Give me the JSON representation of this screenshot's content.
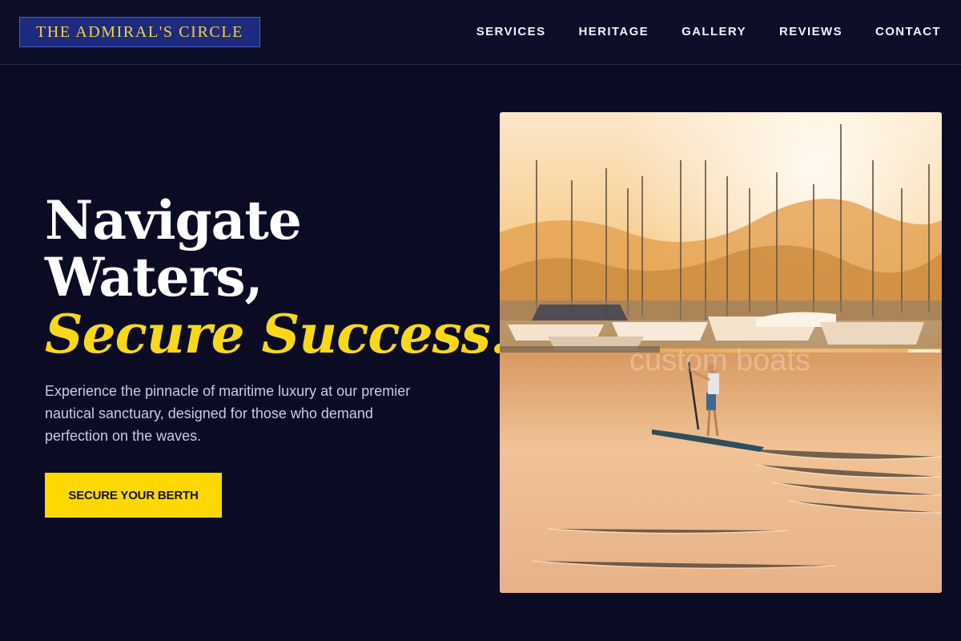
{
  "brand": {
    "logo_text": "THE ADMIRAL'S CIRCLE"
  },
  "nav": {
    "items": [
      {
        "label": "SERVICES"
      },
      {
        "label": "HERITAGE"
      },
      {
        "label": "GALLERY"
      },
      {
        "label": "REVIEWS"
      },
      {
        "label": "CONTACT"
      }
    ]
  },
  "hero": {
    "title_line1": "Navigate",
    "title_line2": "Waters,",
    "title_accent": "Secure Success.",
    "subtitle": "Experience the pinnacle of maritime luxury at our premier nautical sanctuary, designed for those who demand perfection on the waves.",
    "cta_label": "SECURE YOUR BERTH",
    "image_watermark": "custom boats"
  },
  "colors": {
    "background": "#0b0c24",
    "accent": "#ffd800",
    "logo_bg": "#1e2a7e",
    "logo_text": "#f6d33a"
  }
}
